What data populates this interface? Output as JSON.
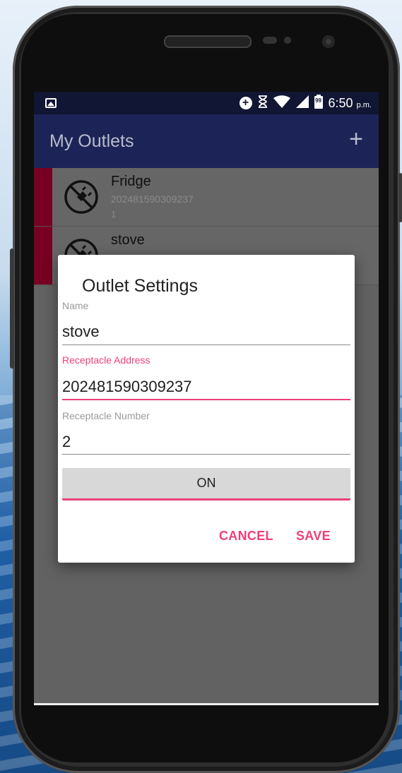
{
  "status_bar": {
    "time": "6:50",
    "time_suffix": "p.m.",
    "battery_level": "99",
    "icons": [
      "image-icon",
      "data-saver-icon",
      "hourglass-icon",
      "wifi-icon",
      "signal-icon",
      "battery-icon"
    ]
  },
  "app_bar": {
    "title": "My Outlets",
    "add_label": "+"
  },
  "outlets": [
    {
      "name": "Fridge",
      "address": "202481590309237",
      "number": "1"
    },
    {
      "name": "stove",
      "address": "",
      "number": ""
    }
  ],
  "dialog": {
    "title": "Outlet Settings",
    "name_label": "Name",
    "name_value": "stove",
    "address_label": "Receptacle Address",
    "address_value": "202481590309237",
    "number_label": "Receptacle Number",
    "number_value": "2",
    "toggle_label": "ON",
    "cancel_label": "CANCEL",
    "save_label": "SAVE"
  },
  "colors": {
    "app_bar": "#1c2457",
    "status_bar": "#101633",
    "accent": "#ec407a",
    "outlet_accent": "#780022"
  }
}
